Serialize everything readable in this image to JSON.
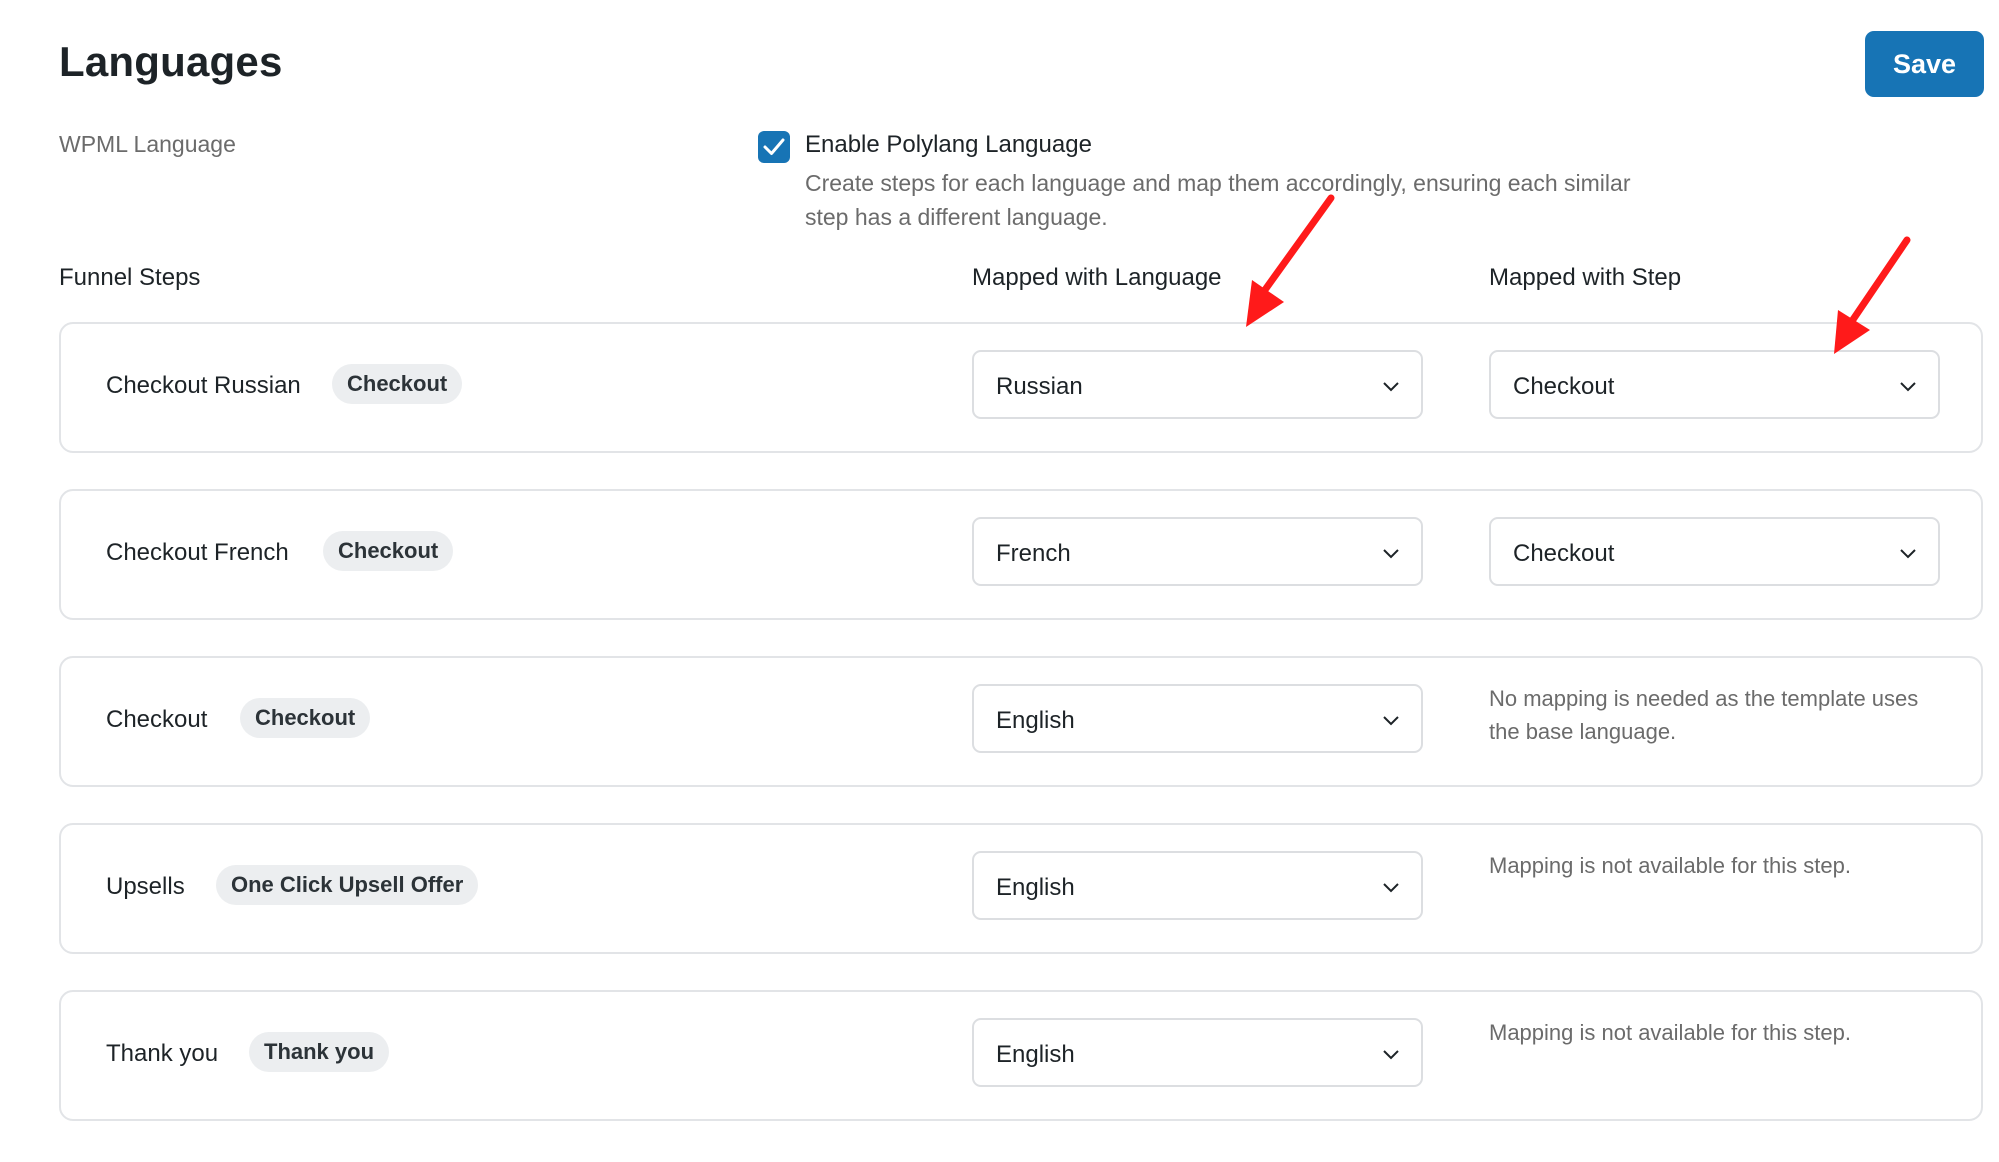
{
  "page": {
    "title": "Languages",
    "save_label": "Save",
    "wpml_label": "WPML Language",
    "polylang": {
      "checked": true,
      "label": "Enable Polylang Language",
      "description": "Create steps for each language and map them accordingly, ensuring each similar step has a different language."
    }
  },
  "columns": {
    "steps": "Funnel Steps",
    "language": "Mapped with Language",
    "step": "Mapped with Step"
  },
  "rows": [
    {
      "name": "Checkout Russian",
      "badge": "Checkout",
      "language": "Russian",
      "step": "Checkout",
      "note": ""
    },
    {
      "name": "Checkout French",
      "badge": "Checkout",
      "language": "French",
      "step": "Checkout",
      "note": ""
    },
    {
      "name": "Checkout",
      "badge": "Checkout",
      "language": "English",
      "step": "",
      "note": "No mapping is needed as the template uses the base language."
    },
    {
      "name": "Upsells",
      "badge": "One Click Upsell Offer",
      "language": "English",
      "step": "",
      "note": "Mapping is not available for this step."
    },
    {
      "name": "Thank you",
      "badge": "Thank you",
      "language": "English",
      "step": "",
      "note": "Mapping is not available for this step."
    }
  ],
  "colors": {
    "accent": "#1774b5",
    "annotation_arrow": "#ff1a1a"
  },
  "icons": {
    "checkbox": "check-icon",
    "select": "chevron-down-icon",
    "annotation": "red-arrow-icon"
  }
}
